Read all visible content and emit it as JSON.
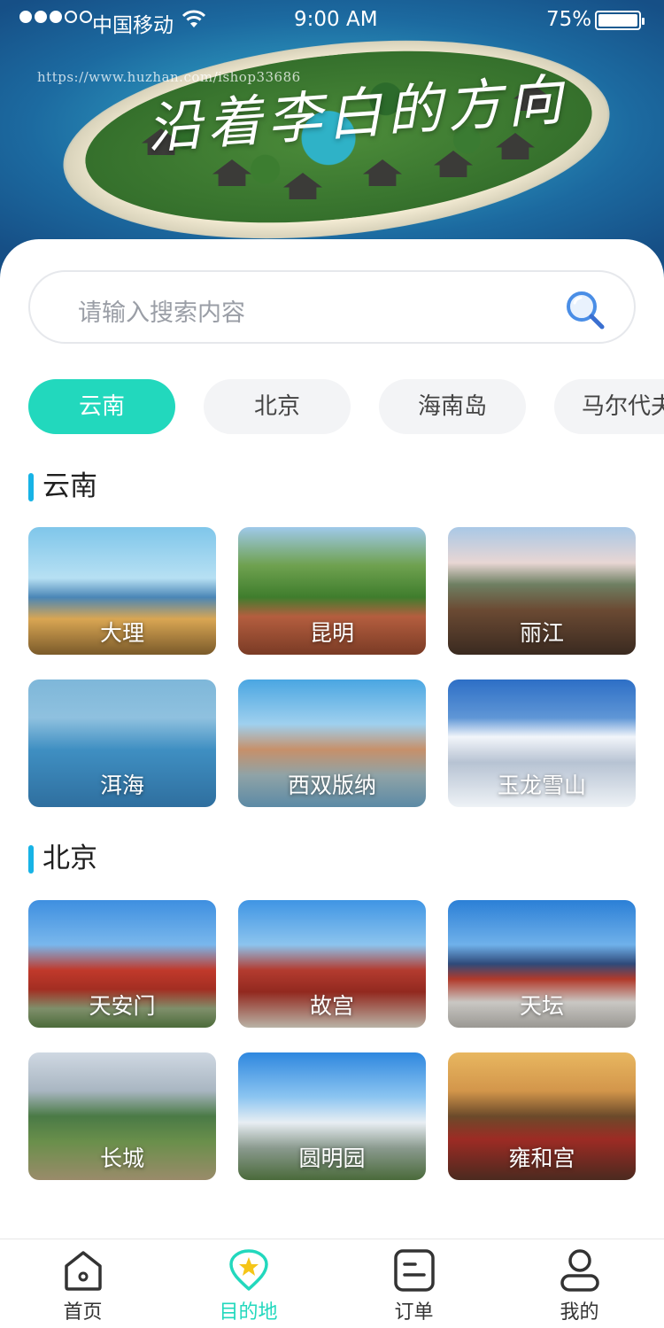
{
  "status_bar": {
    "carrier": "中国移动",
    "time": "9:00 AM",
    "battery": "75%"
  },
  "hero": {
    "watermark": "https://www.huzhan.com/ishop33686",
    "slogan": "沿着李白的方向"
  },
  "search": {
    "placeholder": "请输入搜索内容"
  },
  "chips": [
    {
      "label": "云南",
      "active": true
    },
    {
      "label": "北京",
      "active": false
    },
    {
      "label": "海南岛",
      "active": false
    },
    {
      "label": "马尔代夫",
      "active": false
    }
  ],
  "sections": [
    {
      "title": "云南",
      "items": [
        "大理",
        "昆明",
        "丽江",
        "洱海",
        "西双版纳",
        "玉龙雪山"
      ]
    },
    {
      "title": "北京",
      "items": [
        "天安门",
        "故宫",
        "天坛",
        "长城",
        "圆明园",
        "雍和宫"
      ]
    }
  ],
  "tabbar": [
    {
      "label": "首页",
      "icon": "home-icon",
      "active": false
    },
    {
      "label": "目的地",
      "icon": "destination-icon",
      "active": true
    },
    {
      "label": "订单",
      "icon": "order-icon",
      "active": false
    },
    {
      "label": "我的",
      "icon": "profile-icon",
      "active": false
    }
  ],
  "colors": {
    "accent": "#22d8bd",
    "section_marker": "#17b3e6",
    "chip_inactive": "#f3f4f6"
  }
}
